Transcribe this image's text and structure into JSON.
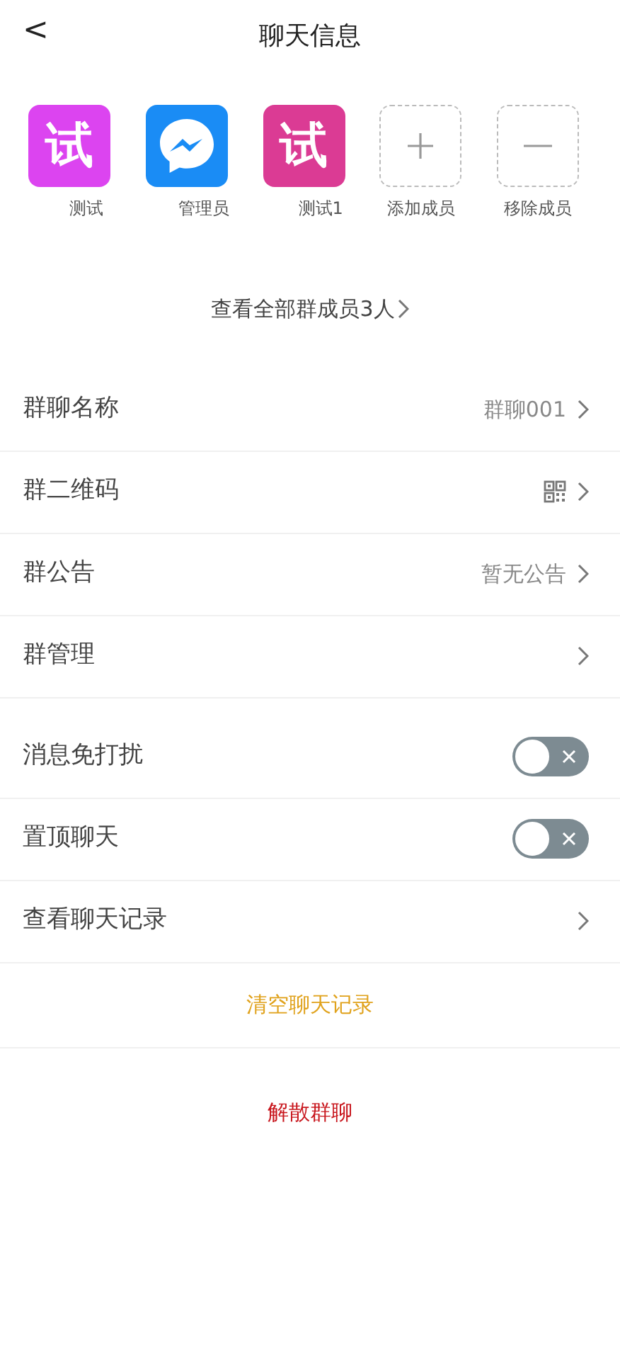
{
  "header": {
    "back": "<",
    "title": "聊天信息"
  },
  "members": [
    {
      "kind": "text",
      "avatar_text": "试",
      "color": "#dc44f0",
      "name": "测试"
    },
    {
      "kind": "logo",
      "color": "#1a8cf5",
      "name": "管理员"
    },
    {
      "kind": "text",
      "avatar_text": "试",
      "color": "#db3b94",
      "name": "测试1"
    },
    {
      "kind": "add",
      "name": "添加成员"
    },
    {
      "kind": "remove",
      "name": "移除成员"
    }
  ],
  "view_all": {
    "label": "查看全部群成员3人"
  },
  "info_rows": [
    {
      "kind": "value",
      "label": "群聊名称",
      "value": "群聊001"
    },
    {
      "kind": "qr",
      "label": "群二维码"
    },
    {
      "kind": "value",
      "label": "群公告",
      "value": "暂无公告"
    },
    {
      "kind": "link",
      "label": "群管理"
    }
  ],
  "setting_rows": [
    {
      "kind": "switch",
      "label": "消息免打扰",
      "on": false
    },
    {
      "kind": "switch",
      "label": "置顶聊天",
      "on": false
    },
    {
      "kind": "link",
      "label": "查看聊天记录"
    }
  ],
  "actions": [
    {
      "label": "清空聊天记录",
      "color": "#e0a21c"
    },
    {
      "label": "解散群聊",
      "color": "#c8161d"
    }
  ]
}
